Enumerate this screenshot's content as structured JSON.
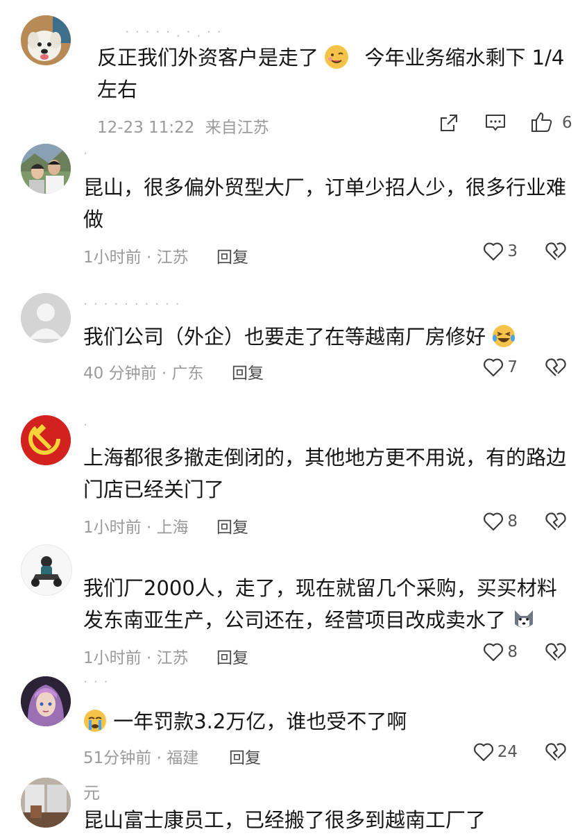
{
  "comments": [
    {
      "username": "· · ·  ·  ·  . · . · ·",
      "text_parts": [
        "反正我们外资客户是走了",
        "今年业务缩水剩下 1/4",
        "左右"
      ],
      "emoji": "yum-emoji",
      "time": "12-23 11:22",
      "location": "来自江苏",
      "likes": "6",
      "icons": [
        "share-icon",
        "comment-icon",
        "thumbs-up-icon"
      ]
    },
    {
      "username": "·",
      "text": "昆山，很多偏外贸型大厂，订单少招人少，很多行业难",
      "text_line2": "做",
      "time": "1小时前",
      "location": "江苏",
      "reply_label": "回复",
      "likes": "3"
    },
    {
      "username": "·         · · · · · · · · ·",
      "text": "我们公司（外企）也要走了在等越南厂房修好",
      "emoji": "laughing-tears-emoji",
      "time": "40 分钟前",
      "location": "广东",
      "reply_label": "回复",
      "likes": "7"
    },
    {
      "username": "·",
      "text": "上海都很多撤走倒闭的，其他地方更不用说，有的路边",
      "text_line2": "门店已经关门了",
      "time": "1小时前",
      "location": "上海",
      "reply_label": "回复",
      "likes": "8"
    },
    {
      "username": "",
      "text": "我们厂2000人，走了，现在就留几个采购，买买材料",
      "text_line2": "发东南亚生产，公司还在，经营项目改成卖水了",
      "emoji": "husky-emoji",
      "time": "1小时前",
      "location": "江苏",
      "reply_label": "回复",
      "likes": "8"
    },
    {
      "username": "· · ·",
      "emoji": "crying-emoji",
      "text": "一年罚款3.2万亿，谁也受不了啊",
      "time": "51分钟前",
      "location": "福建",
      "reply_label": "回复",
      "likes": "24"
    },
    {
      "username": "元",
      "text": "昆山富士康员工，已经搬了很多到越南工厂了"
    }
  ],
  "colors": {
    "icon": "#3a3a3a",
    "meta": "#9a9a9a",
    "background": "#ffffff"
  }
}
